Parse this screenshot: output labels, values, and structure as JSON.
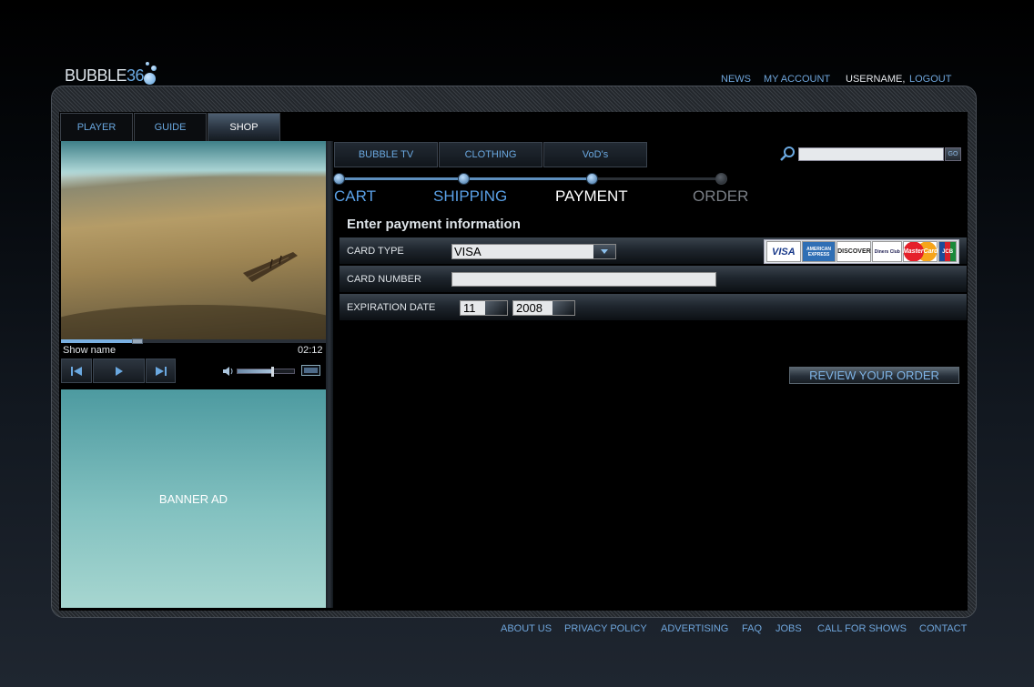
{
  "brand": {
    "logo_text": "BUBBLE",
    "logo_num": "36"
  },
  "topnav": {
    "news": "NEWS",
    "my_account": "MY ACCOUNT",
    "username": "USERNAME,",
    "logout": "LOGOUT"
  },
  "main_tabs": [
    {
      "label": "PLAYER"
    },
    {
      "label": "GUIDE"
    },
    {
      "label": "SHOP",
      "active": true
    }
  ],
  "player": {
    "show_name": "Show name",
    "time": "02:12",
    "progress": 0.29,
    "volume": 0.62
  },
  "banner": {
    "label": "BANNER AD"
  },
  "shop": {
    "subtabs": [
      {
        "label": "BUBBLE TV"
      },
      {
        "label": "CLOTHING"
      },
      {
        "label": "VoD's"
      }
    ],
    "search": {
      "placeholder": "",
      "go_label": "GO"
    },
    "steps": [
      {
        "label": "CART",
        "state": "done",
        "color": "#5aa0e6"
      },
      {
        "label": "SHIPPING",
        "state": "done",
        "color": "#5aa0e6"
      },
      {
        "label": "PAYMENT",
        "state": "current",
        "color": "#ffffff"
      },
      {
        "label": "ORDER",
        "state": "pending",
        "color": "#7a7f86"
      }
    ],
    "section_title": "Enter payment information",
    "form": {
      "card_type_label": "CARD TYPE",
      "card_type_value": "VISA",
      "card_number_label": "CARD NUMBER",
      "card_number_value": "",
      "expiration_label": "EXPIRATION DATE",
      "exp_month": "11",
      "exp_year": "2008"
    },
    "accepted_cards": [
      "VISA",
      "AMERICAN EXPRESS",
      "DISCOVER",
      "Diners Club",
      "MasterCard",
      "JCB"
    ],
    "review_button": "REVIEW YOUR ORDER"
  },
  "footer": [
    "ABOUT US",
    "PRIVACY POLICY",
    "ADVERTISING",
    "FAQ",
    "JOBS",
    "CALL FOR SHOWS",
    "CONTACT"
  ],
  "colors": {
    "accent": "#6aa8e0",
    "background": "#000000"
  }
}
